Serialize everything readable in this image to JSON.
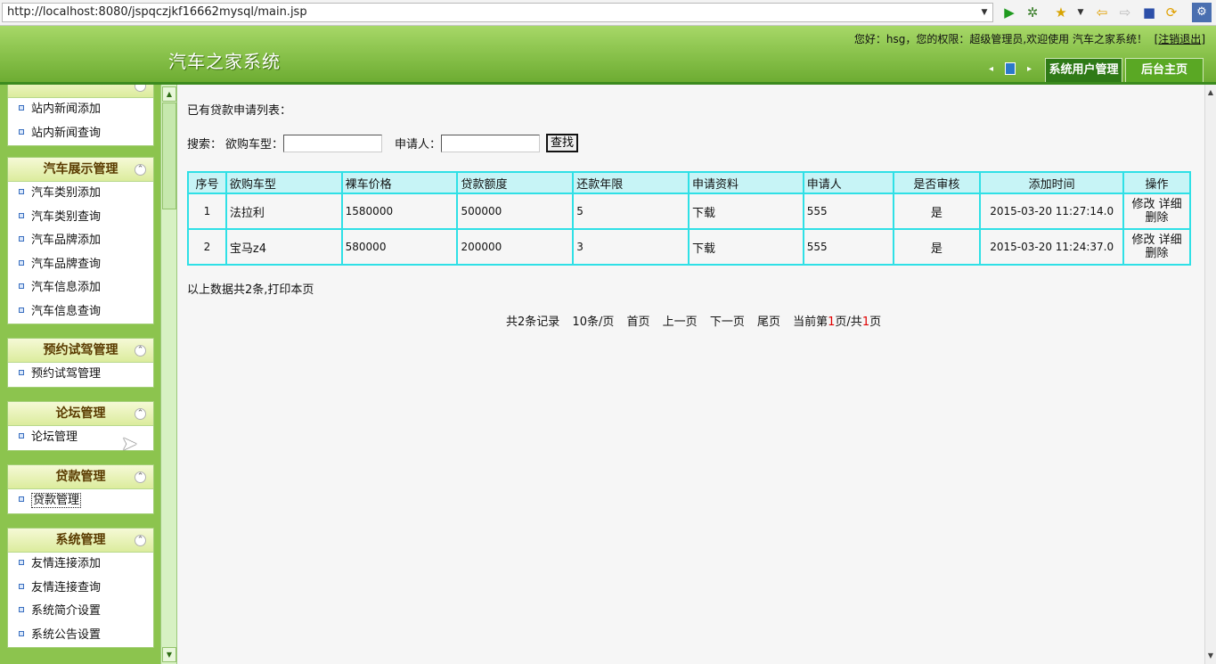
{
  "browser": {
    "url": "http://localhost:8080/jspqczjkf16662mysql/main.jsp"
  },
  "header": {
    "app_title": "汽车之家系统",
    "welcome": "您好：hsg，您的权限：超级管理员,欢迎使用 汽车之家系统！",
    "logout_label": "注销退出",
    "tabs": [
      {
        "label": "系统用户管理"
      },
      {
        "label": "后台主页"
      }
    ]
  },
  "sidebar": {
    "panels": [
      {
        "title": "",
        "items": [
          {
            "label": "站内新闻添加"
          },
          {
            "label": "站内新闻查询"
          }
        ]
      },
      {
        "title": "汽车展示管理",
        "items": [
          {
            "label": "汽车类别添加"
          },
          {
            "label": "汽车类别查询"
          },
          {
            "label": "汽车品牌添加"
          },
          {
            "label": "汽车品牌查询"
          },
          {
            "label": "汽车信息添加"
          },
          {
            "label": "汽车信息查询"
          }
        ]
      },
      {
        "title": "预约试驾管理",
        "items": [
          {
            "label": "预约试驾管理"
          }
        ]
      },
      {
        "title": "论坛管理",
        "items": [
          {
            "label": "论坛管理"
          }
        ]
      },
      {
        "title": "贷款管理",
        "items": [
          {
            "label": "贷款管理"
          }
        ]
      },
      {
        "title": "系统管理",
        "items": [
          {
            "label": "友情连接添加"
          },
          {
            "label": "友情连接查询"
          },
          {
            "label": "系统简介设置"
          },
          {
            "label": "系统公告设置"
          }
        ]
      }
    ]
  },
  "main": {
    "list_title": "已有贷款申请列表：",
    "search": {
      "label": "搜索：",
      "car_label": "欲购车型：",
      "car_value": "",
      "applicant_label": "申请人：",
      "applicant_value": "",
      "button": "查找"
    },
    "table": {
      "headers": [
        "序号",
        "欲购车型",
        "裸车价格",
        "贷款额度",
        "还款年限",
        "申请资料",
        "申请人",
        "是否审核",
        "添加时间",
        "操作"
      ],
      "rows": [
        {
          "no": "1",
          "car": "法拉利",
          "price": "1580000",
          "loan": "500000",
          "years": "5",
          "doc": "下载",
          "applicant": "555",
          "reviewed": "是",
          "time": "2015-03-20 11:27:14.0",
          "edit": "修改",
          "detail": "详细",
          "delete": "删除"
        },
        {
          "no": "2",
          "car": "宝马z4",
          "price": "580000",
          "loan": "200000",
          "years": "3",
          "doc": "下载",
          "applicant": "555",
          "reviewed": "是",
          "time": "2015-03-20 11:24:37.0",
          "edit": "修改",
          "detail": "详细",
          "delete": "删除"
        }
      ]
    },
    "total_line": "以上数据共2条,",
    "print_label": "打印本页",
    "pager": {
      "records": "共2条记录",
      "per_page": "10条/页",
      "first": "首页",
      "prev": "上一页",
      "next": "下一页",
      "last": "尾页",
      "current_prefix": "当前第",
      "current_page": "1",
      "mid": "页/共",
      "total_pages": "1",
      "suffix": "页"
    }
  }
}
